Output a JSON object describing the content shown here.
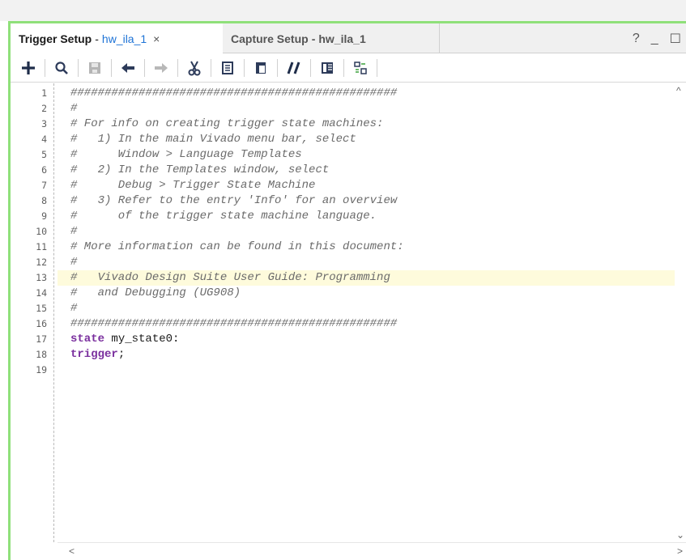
{
  "tabs": [
    {
      "title": "Trigger Setup",
      "sep": "-",
      "subtitle": "hw_ila_1",
      "close": "×",
      "active": true
    },
    {
      "title": "Capture Setup",
      "sep": "-",
      "subtitle": "hw_ila_1",
      "active": false
    }
  ],
  "window_controls": {
    "help": "?",
    "minimize": "_",
    "maximize": "☐"
  },
  "toolbar": {
    "icons": [
      "add-icon",
      "search-icon",
      "save-icon",
      "undo-icon",
      "redo-icon",
      "cut-icon",
      "copy-icon",
      "paste-icon",
      "comment-toggle-icon",
      "split-view-icon",
      "insert-template-icon"
    ]
  },
  "editor": {
    "highlighted_line": 13,
    "lines": [
      {
        "n": "1",
        "text": "################################################",
        "style": "cmt"
      },
      {
        "n": "2",
        "text": "#",
        "style": "cmt"
      },
      {
        "n": "3",
        "text": "# For info on creating trigger state machines:",
        "style": "cmt"
      },
      {
        "n": "4",
        "text": "#   1) In the main Vivado menu bar, select",
        "style": "cmt"
      },
      {
        "n": "5",
        "text": "#      Window > Language Templates",
        "style": "cmt"
      },
      {
        "n": "6",
        "text": "#   2) In the Templates window, select",
        "style": "cmt"
      },
      {
        "n": "7",
        "text": "#      Debug > Trigger State Machine",
        "style": "cmt"
      },
      {
        "n": "8",
        "text": "#   3) Refer to the entry 'Info' for an overview",
        "style": "cmt"
      },
      {
        "n": "9",
        "text": "#      of the trigger state machine language.",
        "style": "cmt"
      },
      {
        "n": "10",
        "text": "#",
        "style": "cmt"
      },
      {
        "n": "11",
        "text": "# More information can be found in this document:",
        "style": "cmt"
      },
      {
        "n": "12",
        "text": "#",
        "style": "cmt"
      },
      {
        "n": "13",
        "text": "#   Vivado Design Suite User Guide: Programming",
        "style": "cmt"
      },
      {
        "n": "14",
        "text": "#   and Debugging (UG908)",
        "style": "cmt"
      },
      {
        "n": "15",
        "text": "#",
        "style": "cmt"
      },
      {
        "n": "16",
        "text": "################################################",
        "style": "cmt"
      },
      {
        "n": "17",
        "kw": "state",
        "rest": " my_state0:",
        "style": "code"
      },
      {
        "n": "18",
        "kw": "trigger",
        "rest": ";",
        "style": "code"
      },
      {
        "n": "19",
        "text": "",
        "style": "cmt"
      }
    ]
  },
  "scroll": {
    "up": "^",
    "down": "⌄",
    "left": "<",
    "right": ">"
  },
  "colors": {
    "panel_border": "#8fe07a",
    "tab_link": "#1e73d6",
    "keyword": "#7a2f9e",
    "highlight": "#fefbdc"
  }
}
